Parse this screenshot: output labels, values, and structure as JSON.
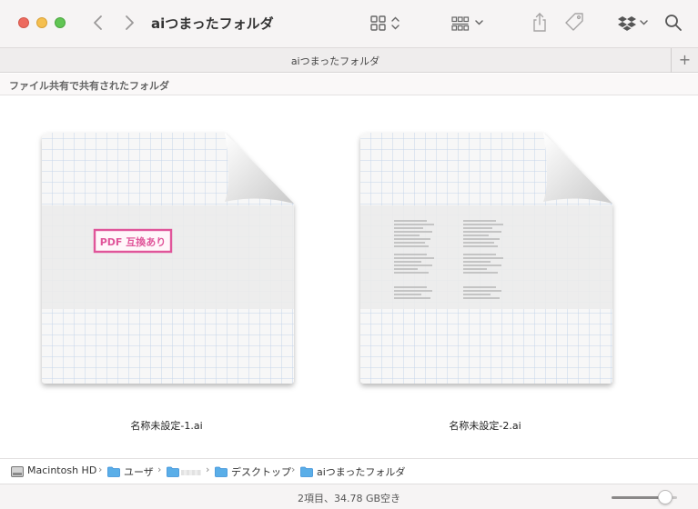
{
  "window": {
    "title": "aiつまったフォルダ"
  },
  "toolbar": {
    "back_icon": "chevron-left-icon",
    "forward_icon": "chevron-right-icon",
    "view_icon": "grid-view-icon",
    "group_icon": "group-by-icon",
    "share_icon": "share-icon",
    "tag_icon": "tag-icon",
    "dropbox_icon": "dropbox-icon",
    "search_icon": "magnifier-icon"
  },
  "tab": {
    "title": "aiつまったフォルダ",
    "add_label": "+"
  },
  "shared_header": {
    "label": "ファイル共有で共有されたフォルダ"
  },
  "files": [
    {
      "name": "名称未設定-1.ai",
      "stamp": "PDF 互換あり"
    },
    {
      "name": "名称未設定-2.ai"
    }
  ],
  "pathbar": {
    "items": [
      {
        "label": "Macintosh HD",
        "icon": "hard-drive-icon"
      },
      {
        "label": "ユーザ",
        "icon": "folder-icon"
      },
      {
        "label": "",
        "icon": "folder-icon"
      },
      {
        "label": "デスクトップ",
        "icon": "folder-icon"
      },
      {
        "label": "aiつまったフォルダ",
        "icon": "folder-icon"
      }
    ],
    "separator": "›"
  },
  "status": {
    "text": "2項目、34.78 GB空き",
    "icon_size_slider": 0.82
  },
  "colors": {
    "accent": "#3a8fd8",
    "stamp": "#e0559a",
    "folder": "#5aaee8"
  }
}
